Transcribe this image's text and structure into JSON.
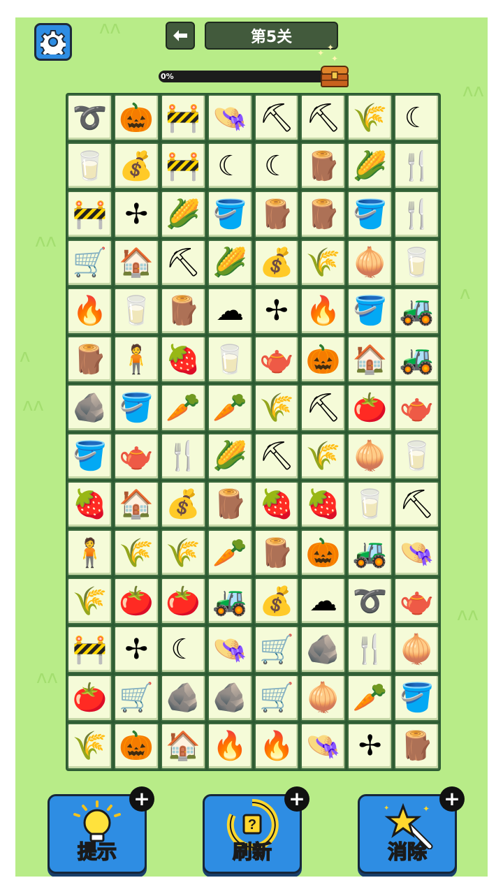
{
  "header": {
    "settings_icon": "gear-icon",
    "back_icon": "arrow-left-icon",
    "level_title": "第5关"
  },
  "progress": {
    "label": "0%",
    "value": 0,
    "reward_icon": "treasure-chest-icon"
  },
  "board": {
    "rows": 14,
    "cols": 8,
    "tiles": [
      [
        "rope",
        "pumpkin",
        "fence",
        "straw-hat",
        "shovel",
        "shovel",
        "haystack",
        "sickle"
      ],
      [
        "milk",
        "seed-bag",
        "fence",
        "sickle",
        "sickle",
        "logs",
        "corn",
        "fork"
      ],
      [
        "fence",
        "windmill",
        "corn",
        "bucket",
        "stump",
        "stump",
        "bucket",
        "fork"
      ],
      [
        "wheelbarrow",
        "doghouse",
        "shovel",
        "corn",
        "seed-bag",
        "wheat",
        "onion",
        "milk"
      ],
      [
        "campfire",
        "milk",
        "logs",
        "cotton",
        "windmill",
        "campfire",
        "bucket",
        "tractor"
      ],
      [
        "logs",
        "scarecrow",
        "strawberry",
        "milk",
        "watering-can",
        "pumpkin",
        "doghouse",
        "tractor"
      ],
      [
        "rock",
        "bucket",
        "carrot",
        "carrot",
        "wheat",
        "shovel",
        "tomato",
        "watering-can"
      ],
      [
        "bucket",
        "watering-can",
        "fork",
        "corn",
        "shovel",
        "haystack",
        "onion",
        "milk"
      ],
      [
        "strawberry",
        "doghouse",
        "seed-bag",
        "logs",
        "strawberry",
        "strawberry",
        "milk",
        "shovel"
      ],
      [
        "scarecrow",
        "wheat",
        "haystack",
        "carrot",
        "stump",
        "pumpkin",
        "tractor",
        "straw-hat"
      ],
      [
        "haystack",
        "tomato",
        "tomato",
        "tractor",
        "seed-bag",
        "cotton",
        "rope",
        "watering-can"
      ],
      [
        "fence",
        "windmill",
        "sickle",
        "straw-hat",
        "wheelbarrow",
        "rock",
        "fork",
        "onion"
      ],
      [
        "tomato",
        "wheelbarrow",
        "rock",
        "rock",
        "wheelbarrow",
        "onion",
        "carrot",
        "bucket"
      ],
      [
        "wheat",
        "pumpkin",
        "doghouse",
        "campfire",
        "campfire",
        "straw-hat",
        "windmill",
        "stump"
      ]
    ]
  },
  "glyphs": {
    "rope": "➰",
    "pumpkin": "🎃",
    "fence": "🚧",
    "straw-hat": "👒",
    "shovel": "⛏",
    "haystack": "🌾",
    "sickle": "☾",
    "milk": "🥛",
    "seed-bag": "💰",
    "logs": "🪵",
    "corn": "🌽",
    "fork": "🍴",
    "windmill": "✢",
    "bucket": "🪣",
    "stump": "🪵",
    "wheelbarrow": "🛒",
    "doghouse": "🏠",
    "wheat": "🌾",
    "onion": "🧅",
    "campfire": "🔥",
    "cotton": "☁",
    "tractor": "🚜",
    "scarecrow": "🧍",
    "strawberry": "🍓",
    "watering-can": "🫖",
    "rock": "🪨",
    "carrot": "🥕",
    "tomato": "🍅"
  },
  "tools": [
    {
      "label": "提示",
      "icon": "lightbulb-icon",
      "add_icon": "plus-icon",
      "add": "+"
    },
    {
      "label": "刷新",
      "icon": "refresh-icon",
      "add_icon": "plus-icon",
      "add": "+"
    },
    {
      "label": "消除",
      "icon": "magic-wand-icon",
      "add_icon": "plus-icon",
      "add": "+"
    }
  ],
  "colors": {
    "background": "#b8ec88",
    "accent_blue": "#2e8de3",
    "header_dark": "#425a3c",
    "tile_face": "#f5fbd8"
  }
}
